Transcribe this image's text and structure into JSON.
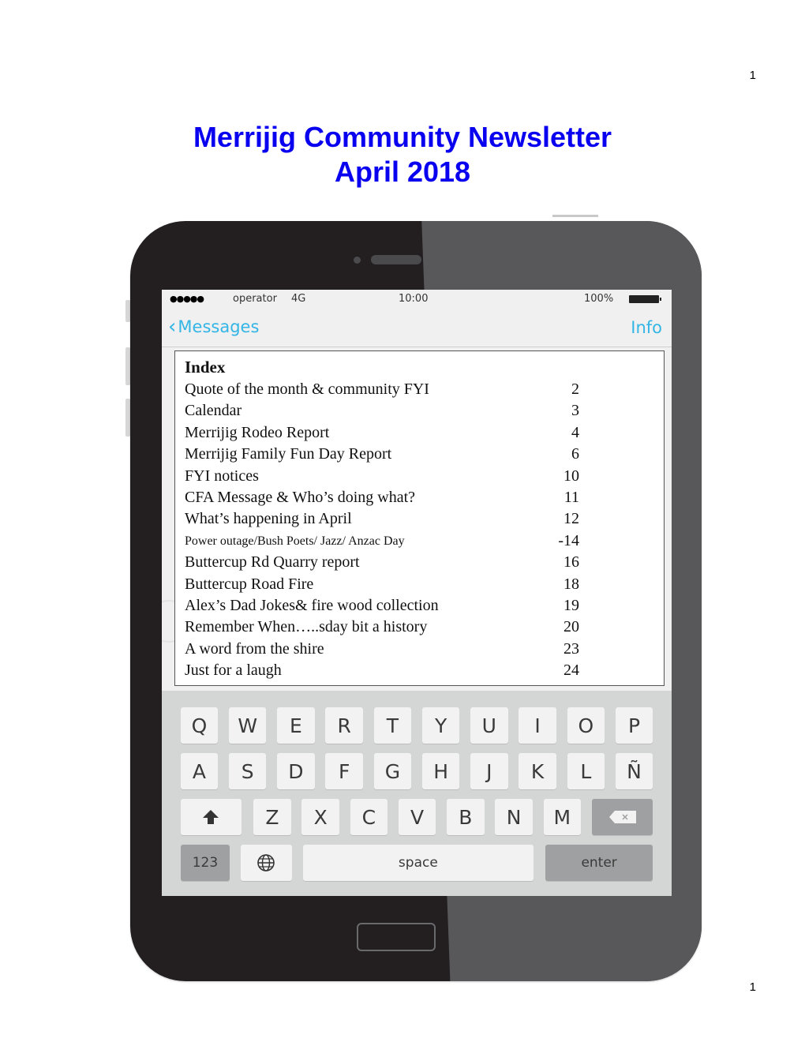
{
  "page": {
    "number_top": "1",
    "number_bottom": "1"
  },
  "title": {
    "line1": "Merrijig Community Newsletter",
    "line2": "April 2018",
    "color": "#0a00f0"
  },
  "phone": {
    "status_bar": {
      "signal_dots": "●●●●●",
      "operator": "operator",
      "network": "4G",
      "time": "10:00",
      "battery_percent": "100%"
    },
    "nav": {
      "back_label": "Messages",
      "back_icon": "chevron-left-icon",
      "info_label": "Info",
      "accent_color": "#33b5e5"
    },
    "index": {
      "heading": "Index",
      "items": [
        {
          "label": "Quote of the month & community FYI",
          "page": "2"
        },
        {
          "label": "Calendar",
          "page": "3"
        },
        {
          "label": "Merrijig Rodeo Report",
          "page": "4"
        },
        {
          "label": "Merrijig Family Fun Day Report",
          "page": "6"
        },
        {
          "label": "FYI notices",
          "page": "10"
        },
        {
          "label": "CFA Message & Who’s doing what?",
          "page": "11"
        },
        {
          "label": "What’s happening in April",
          "page": "12"
        },
        {
          "label": "Power outage/Bush Poets/ Jazz/ Anzac Day",
          "page": "-14"
        },
        {
          "label": "Buttercup Rd Quarry report",
          "page": "16"
        },
        {
          "label": "Buttercup Road Fire",
          "page": "18"
        },
        {
          "label": "Alex’s Dad Jokes& fire wood collection",
          "page": "19"
        },
        {
          "label": "Remember When…..sday bit a history",
          "page": "20"
        },
        {
          "label": "A word from the shire",
          "page": "23"
        },
        {
          "label": "Just for a laugh",
          "page": "24"
        }
      ]
    },
    "keyboard": {
      "row1": [
        "Q",
        "W",
        "E",
        "R",
        "T",
        "Y",
        "U",
        "I",
        "O",
        "P"
      ],
      "row2": [
        "A",
        "S",
        "D",
        "F",
        "G",
        "H",
        "J",
        "K",
        "L",
        "Ñ"
      ],
      "row3": [
        "Z",
        "X",
        "C",
        "V",
        "B",
        "N",
        "M"
      ],
      "shift_icon": "shift-arrow-icon",
      "backspace_icon": "backspace-icon",
      "numbers_label": "123",
      "globe_icon": "globe-icon",
      "space_label": "space",
      "enter_label": "enter"
    }
  }
}
